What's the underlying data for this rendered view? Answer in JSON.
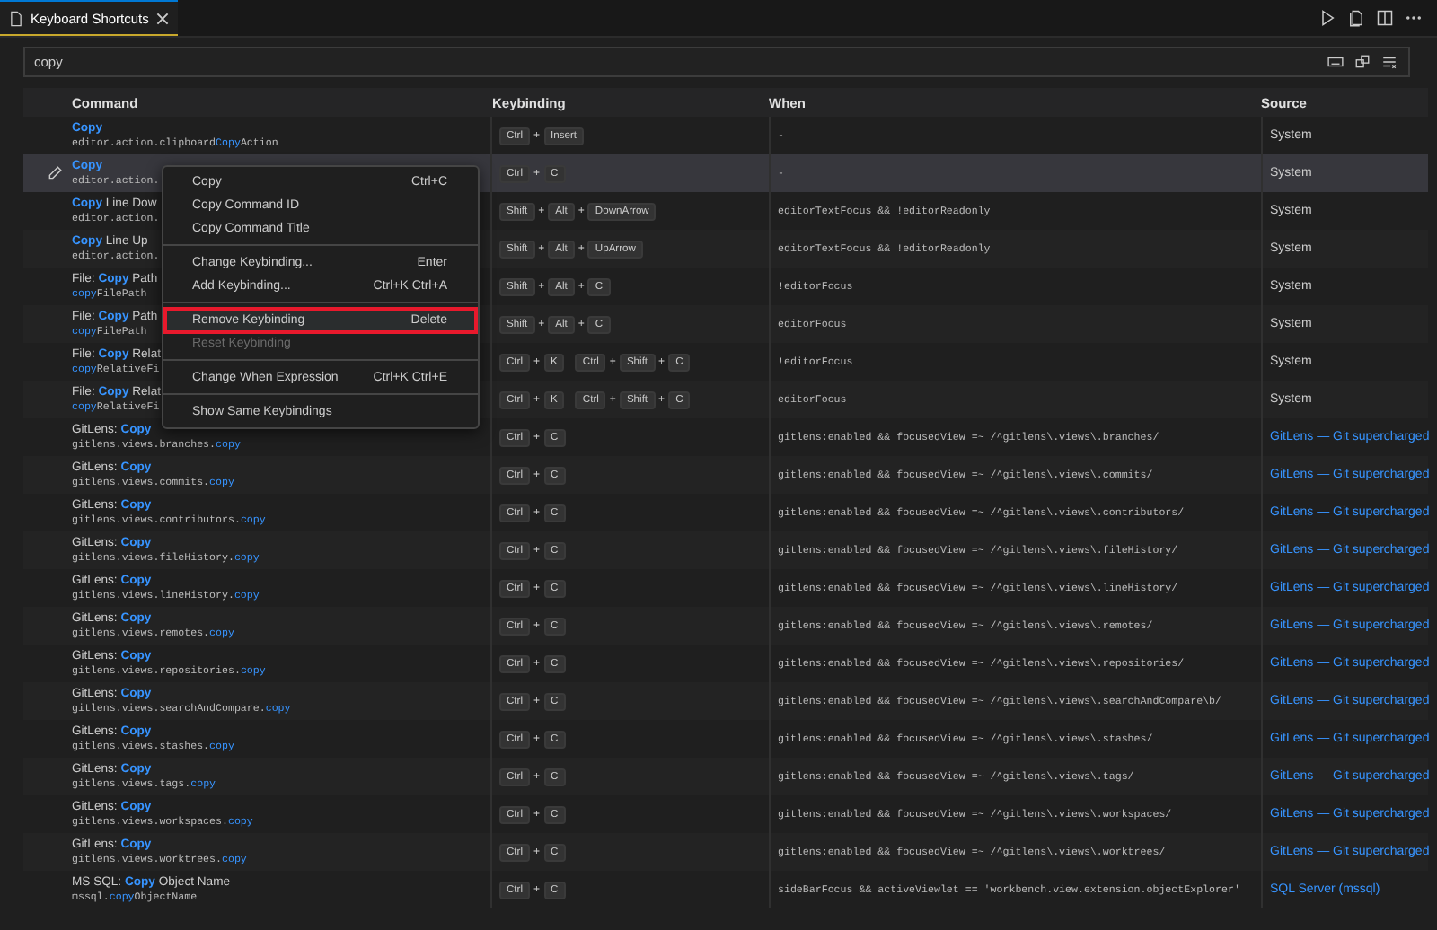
{
  "tab": {
    "title": "Keyboard Shortcuts",
    "selected": true
  },
  "search": {
    "value": "copy"
  },
  "columns": [
    "Command",
    "Keybinding",
    "When",
    "Source"
  ],
  "key_separator": "+",
  "rows": [
    {
      "title": "**Copy**",
      "id": "editor.action.clipboard**Copy**Action",
      "keybinding": [
        [
          "Ctrl",
          "Insert"
        ]
      ],
      "when": "-",
      "source": {
        "text": "System",
        "kind": "system"
      },
      "selected": false
    },
    {
      "title": "**Copy**",
      "id": "editor.action.",
      "keybinding": [
        [
          "Ctrl",
          "C"
        ]
      ],
      "when": "-",
      "source": {
        "text": "System",
        "kind": "system"
      },
      "selected": true
    },
    {
      "title": "**Copy** Line Dow",
      "id": "editor.action.",
      "keybinding": [
        [
          "Shift",
          "Alt",
          "DownArrow"
        ]
      ],
      "when": "editorTextFocus && !editorReadonly",
      "source": {
        "text": "System",
        "kind": "system"
      },
      "selected": false
    },
    {
      "title": "**Copy** Line Up",
      "id": "editor.action.",
      "keybinding": [
        [
          "Shift",
          "Alt",
          "UpArrow"
        ]
      ],
      "when": "editorTextFocus && !editorReadonly",
      "source": {
        "text": "System",
        "kind": "system"
      },
      "selected": false
    },
    {
      "title": "File: **Copy** Path",
      "id": "**copy**FilePath",
      "keybinding": [
        [
          "Shift",
          "Alt",
          "C"
        ]
      ],
      "when": "!editorFocus",
      "source": {
        "text": "System",
        "kind": "system"
      },
      "selected": false
    },
    {
      "title": "File: **Copy** Path",
      "id": "**copy**FilePath",
      "keybinding": [
        [
          "Shift",
          "Alt",
          "C"
        ]
      ],
      "when": "editorFocus",
      "source": {
        "text": "System",
        "kind": "system"
      },
      "selected": false
    },
    {
      "title": "File: **Copy** Relat",
      "id": "**copy**RelativeFi",
      "keybinding": [
        [
          "Ctrl",
          "K"
        ],
        [
          "Ctrl",
          "Shift",
          "C"
        ]
      ],
      "when": "!editorFocus",
      "source": {
        "text": "System",
        "kind": "system"
      },
      "selected": false
    },
    {
      "title": "File: **Copy** Relat",
      "id": "**copy**RelativeFi",
      "keybinding": [
        [
          "Ctrl",
          "K"
        ],
        [
          "Ctrl",
          "Shift",
          "C"
        ]
      ],
      "when": "editorFocus",
      "source": {
        "text": "System",
        "kind": "system"
      },
      "selected": false
    },
    {
      "title": "GitLens: **Copy**",
      "id": "gitlens.views.branches.**copy**",
      "keybinding": [
        [
          "Ctrl",
          "C"
        ]
      ],
      "when": "gitlens:enabled && focusedView =~ /^gitlens\\.views\\.branches/",
      "source": {
        "text": "GitLens — Git supercharged",
        "kind": "extension"
      },
      "selected": false
    },
    {
      "title": "GitLens: **Copy**",
      "id": "gitlens.views.commits.**copy**",
      "keybinding": [
        [
          "Ctrl",
          "C"
        ]
      ],
      "when": "gitlens:enabled && focusedView =~ /^gitlens\\.views\\.commits/",
      "source": {
        "text": "GitLens — Git supercharged",
        "kind": "extension"
      },
      "selected": false
    },
    {
      "title": "GitLens: **Copy**",
      "id": "gitlens.views.contributors.**copy**",
      "keybinding": [
        [
          "Ctrl",
          "C"
        ]
      ],
      "when": "gitlens:enabled && focusedView =~ /^gitlens\\.views\\.contributors/",
      "source": {
        "text": "GitLens — Git supercharged",
        "kind": "extension"
      },
      "selected": false
    },
    {
      "title": "GitLens: **Copy**",
      "id": "gitlens.views.fileHistory.**copy**",
      "keybinding": [
        [
          "Ctrl",
          "C"
        ]
      ],
      "when": "gitlens:enabled && focusedView =~ /^gitlens\\.views\\.fileHistory/",
      "source": {
        "text": "GitLens — Git supercharged",
        "kind": "extension"
      },
      "selected": false
    },
    {
      "title": "GitLens: **Copy**",
      "id": "gitlens.views.lineHistory.**copy**",
      "keybinding": [
        [
          "Ctrl",
          "C"
        ]
      ],
      "when": "gitlens:enabled && focusedView =~ /^gitlens\\.views\\.lineHistory/",
      "source": {
        "text": "GitLens — Git supercharged",
        "kind": "extension"
      },
      "selected": false
    },
    {
      "title": "GitLens: **Copy**",
      "id": "gitlens.views.remotes.**copy**",
      "keybinding": [
        [
          "Ctrl",
          "C"
        ]
      ],
      "when": "gitlens:enabled && focusedView =~ /^gitlens\\.views\\.remotes/",
      "source": {
        "text": "GitLens — Git supercharged",
        "kind": "extension"
      },
      "selected": false
    },
    {
      "title": "GitLens: **Copy**",
      "id": "gitlens.views.repositories.**copy**",
      "keybinding": [
        [
          "Ctrl",
          "C"
        ]
      ],
      "when": "gitlens:enabled && focusedView =~ /^gitlens\\.views\\.repositories/",
      "source": {
        "text": "GitLens — Git supercharged",
        "kind": "extension"
      },
      "selected": false
    },
    {
      "title": "GitLens: **Copy**",
      "id": "gitlens.views.searchAndCompare.**copy**",
      "keybinding": [
        [
          "Ctrl",
          "C"
        ]
      ],
      "when": "gitlens:enabled && focusedView =~ /^gitlens\\.views\\.searchAndCompare\\b/",
      "source": {
        "text": "GitLens — Git supercharged",
        "kind": "extension"
      },
      "selected": false
    },
    {
      "title": "GitLens: **Copy**",
      "id": "gitlens.views.stashes.**copy**",
      "keybinding": [
        [
          "Ctrl",
          "C"
        ]
      ],
      "when": "gitlens:enabled && focusedView =~ /^gitlens\\.views\\.stashes/",
      "source": {
        "text": "GitLens — Git supercharged",
        "kind": "extension"
      },
      "selected": false
    },
    {
      "title": "GitLens: **Copy**",
      "id": "gitlens.views.tags.**copy**",
      "keybinding": [
        [
          "Ctrl",
          "C"
        ]
      ],
      "when": "gitlens:enabled && focusedView =~ /^gitlens\\.views\\.tags/",
      "source": {
        "text": "GitLens — Git supercharged",
        "kind": "extension"
      },
      "selected": false
    },
    {
      "title": "GitLens: **Copy**",
      "id": "gitlens.views.workspaces.**copy**",
      "keybinding": [
        [
          "Ctrl",
          "C"
        ]
      ],
      "when": "gitlens:enabled && focusedView =~ /^gitlens\\.views\\.workspaces/",
      "source": {
        "text": "GitLens — Git supercharged",
        "kind": "extension"
      },
      "selected": false
    },
    {
      "title": "GitLens: **Copy**",
      "id": "gitlens.views.worktrees.**copy**",
      "keybinding": [
        [
          "Ctrl",
          "C"
        ]
      ],
      "when": "gitlens:enabled && focusedView =~ /^gitlens\\.views\\.worktrees/",
      "source": {
        "text": "GitLens — Git supercharged",
        "kind": "extension"
      },
      "selected": false
    },
    {
      "title": "MS SQL: **Copy** Object Name",
      "id": "mssql.**copy**ObjectName",
      "keybinding": [
        [
          "Ctrl",
          "C"
        ]
      ],
      "when": "sideBarFocus && activeViewlet == 'workbench.view.extension.objectExplorer'",
      "source": {
        "text": "SQL Server (mssql)",
        "kind": "extension"
      },
      "selected": false
    }
  ],
  "context_menu": [
    {
      "kind": "item",
      "label": "Copy",
      "shortcut": "Ctrl+C",
      "disabled": false,
      "highlighted": false
    },
    {
      "kind": "item",
      "label": "Copy Command ID",
      "disabled": false,
      "highlighted": false
    },
    {
      "kind": "item",
      "label": "Copy Command Title",
      "disabled": false,
      "highlighted": false
    },
    {
      "kind": "separator"
    },
    {
      "kind": "item",
      "label": "Change Keybinding...",
      "shortcut": "Enter",
      "disabled": false,
      "highlighted": false
    },
    {
      "kind": "item",
      "label": "Add Keybinding...",
      "shortcut": "Ctrl+K Ctrl+A",
      "disabled": false,
      "highlighted": false
    },
    {
      "kind": "separator"
    },
    {
      "kind": "item",
      "label": "Remove Keybinding",
      "shortcut": "Delete",
      "disabled": false,
      "highlighted": true
    },
    {
      "kind": "item",
      "label": "Reset Keybinding",
      "disabled": true,
      "highlighted": false
    },
    {
      "kind": "separator"
    },
    {
      "kind": "item",
      "label": "Change When Expression",
      "shortcut": "Ctrl+K Ctrl+E",
      "disabled": false,
      "highlighted": false
    },
    {
      "kind": "separator"
    },
    {
      "kind": "item",
      "label": "Show Same Keybindings",
      "disabled": false,
      "highlighted": false
    }
  ]
}
